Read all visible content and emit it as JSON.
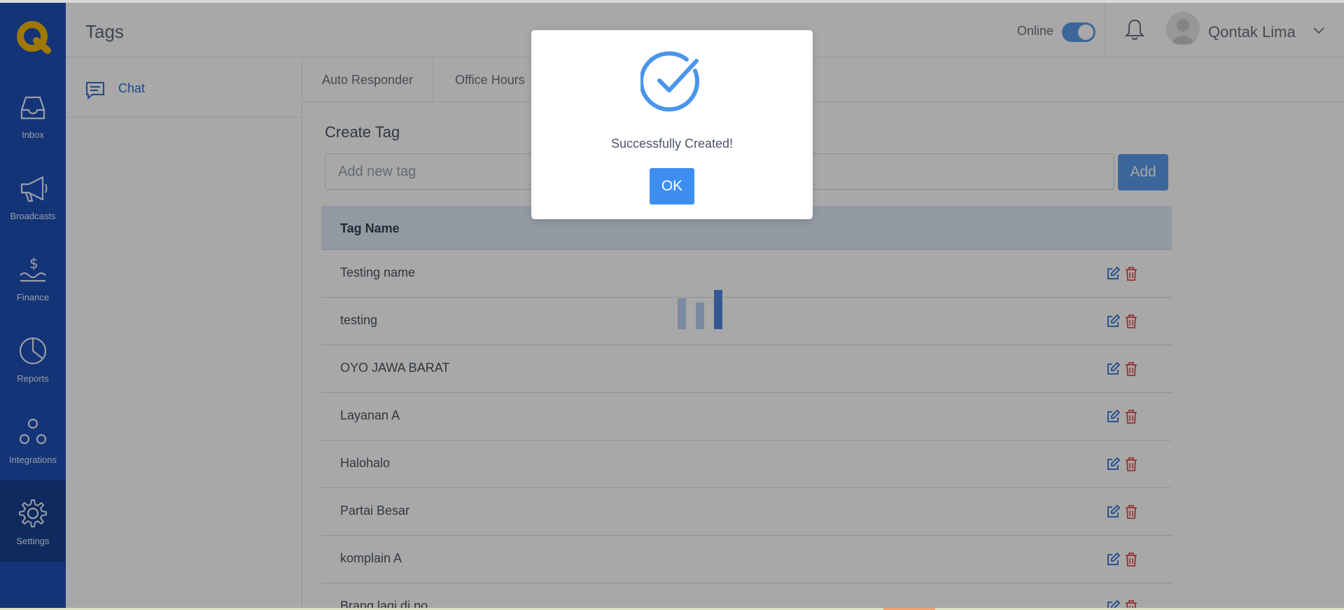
{
  "header": {
    "title": "Tags",
    "online_label": "Online",
    "online_enabled": true,
    "user_name": "Qontak Lima"
  },
  "rail": {
    "items": [
      {
        "label": "Inbox",
        "icon": "inbox-icon"
      },
      {
        "label": "Broadcasts",
        "icon": "megaphone-icon"
      },
      {
        "label": "Finance",
        "icon": "finance-icon"
      },
      {
        "label": "Reports",
        "icon": "pie-chart-icon"
      },
      {
        "label": "Integrations",
        "icon": "integrations-icon"
      },
      {
        "label": "Settings",
        "icon": "gear-icon",
        "active": true
      }
    ]
  },
  "subnav": {
    "items": [
      {
        "label": "Chat",
        "icon": "chat-icon"
      }
    ]
  },
  "tabs": [
    {
      "label": "Auto Responder"
    },
    {
      "label": "Office Hours"
    }
  ],
  "create_tag": {
    "title": "Create Tag",
    "placeholder": "Add new tag",
    "add_label": "Add"
  },
  "table": {
    "header": "Tag Name",
    "rows": [
      "Testing name",
      "testing",
      "OYO JAWA BARAT",
      "Layanan A",
      "Halohalo",
      "Partai Besar",
      "komplain A",
      "Brang lagi di po"
    ]
  },
  "modal": {
    "message": "Successfully Created!",
    "ok_label": "OK"
  },
  "colors": {
    "rail": "#1f4fb7",
    "accent": "#5b9be8",
    "ok_button": "#3d8ef0",
    "delete": "#e04b4b",
    "logo": "#f2b705"
  }
}
